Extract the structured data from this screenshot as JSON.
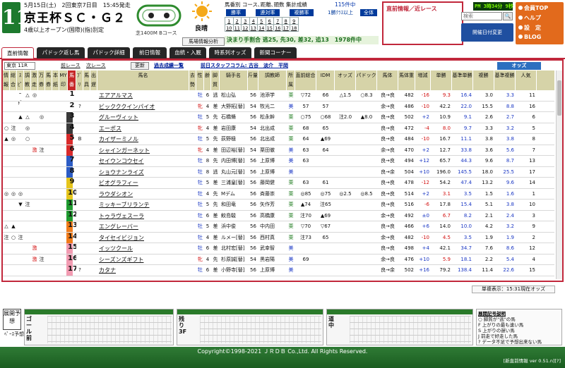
{
  "header": {
    "race_number": "11",
    "dateline": "5月15日(土)　2回東京7日目　15:45発走",
    "race_name": "京王杯ＳＣ・Ｇ２",
    "condition": "4歳以上オープン(国際)(指)別定",
    "course_distance": "芝1400M",
    "course_note": "Bコース",
    "weather": "良晴",
    "handicap_tab": "馬場情報分析"
  },
  "stats": {
    "title": "馬番別 コース､距離､頭数 集計成績",
    "count": "115件中",
    "buttons": [
      "勝率",
      "連対率",
      "複勝率",
      "1勝ｸﾗｽ以上",
      "全体"
    ],
    "row1": [
      "1",
      "2",
      "3",
      "4",
      "5",
      "6",
      "7",
      "8",
      "9"
    ],
    "row2": [
      "10",
      "11",
      "12",
      "13",
      "14",
      "15",
      "16",
      "17",
      "18"
    ],
    "underline_nums": [
      "10",
      "16",
      "17"
    ],
    "result_line": "決まり手割合 逃25, 先30, 差32, 追13　1978件中"
  },
  "direct": {
    "title": "直前情報／近レース"
  },
  "topright": {
    "clock": "PM 3時34分 9秒",
    "search_placeholder": "検索",
    "search_btn": "🔍",
    "schedule_btn": "開催日付変更",
    "menu": [
      "会員TOP",
      "ヘルプ",
      "設　定",
      "BLOG"
    ]
  },
  "tabs": [
    "直前情報",
    "パドック返し馬",
    "パドック詳細",
    "前日情報",
    "血統・入厩",
    "時系列オッズ",
    "新聞コーナー"
  ],
  "controls": {
    "race_select": "東京 11R",
    "prev": "前レース",
    "next": "次レース",
    "update": "更新",
    "past": "過去成績一覧",
    "staff": "前日スタッフコラム: 古谷　淡介　平岡",
    "odds": "オッズ"
  },
  "columns": [
    "情報",
    "総合",
    "ｽﾋﾟｰﾄﾞ",
    "調教",
    "激走",
    "万券",
    "馬券",
    "本紙",
    "MY印",
    "馬番",
    "ﾌﾞﾘ",
    "馬具",
    "出遅",
    "馬名",
    "去勢",
    "性",
    "齢",
    "脚質",
    "騎手名",
    "斤量",
    "調教師",
    "所属",
    "直前総合",
    "IDM",
    "オッズ",
    "パドック",
    "馬体",
    "馬体重",
    "増減",
    "単勝",
    "基準単勝",
    "複勝",
    "基準複勝",
    "人気"
  ],
  "horses": [
    {
      "marks": [
        "",
        "",
        "",
        "△",
        "◎",
        "",
        "",
        "",
        ""
      ],
      "no": "1",
      "gate": "#ffffff",
      "bri": "",
      "name": "エアアルマス",
      "sex": "牡",
      "age": "6",
      "style": "逃",
      "jockey": "松山弘",
      "kin": "56",
      "trainer": "池添学",
      "belong": "栗",
      "chokuzen": "▽72",
      "idm": "66",
      "odds": "△1.5",
      "paddock": "○8.3",
      "body": "良→良",
      "weight": "482",
      "diff": "-16",
      "tan": "9.3",
      "kt": "16.4",
      "fuku": "3.0",
      "kf": "3.3",
      "ninki": "11"
    },
    {
      "marks": [
        "",
        "",
        "",
        "",
        "",
        "",
        "",
        "",
        ""
      ],
      "no": "2",
      "gate": "#ffffff",
      "bri": "?",
      "name": "ビックククインパイオ",
      "sex": "牝",
      "age": "4",
      "style": "差",
      "jockey": "大野拓[替]",
      "kin": "54",
      "trainer": "牧光二",
      "belong": "美",
      "chokuzen": "57",
      "idm": "57",
      "odds": "",
      "paddock": "",
      "body": "余→良",
      "weight": "486",
      "diff": "-10",
      "tan": "42.2",
      "kt": "22.0",
      "fuku": "15.5",
      "kf": "8.8",
      "ninki": "16"
    },
    {
      "marks": [
        "",
        "",
        "▲",
        "△",
        "",
        "◎",
        "",
        "",
        ""
      ],
      "no": "3",
      "gate": "#3a3a3a",
      "bri": "",
      "name": "グルーヴィット",
      "sex": "牡",
      "age": "5",
      "style": "先",
      "jockey": "石橋脩",
      "kin": "56",
      "trainer": "松永幹",
      "belong": "栗",
      "chokuzen": "○75",
      "idm": "○68",
      "odds": "注2.0",
      "paddock": "▲8.0",
      "body": "良→良",
      "weight": "502",
      "diff": "+2",
      "tan": "10.9",
      "kt": "9.1",
      "fuku": "2.6",
      "kf": "2.7",
      "ninki": "6"
    },
    {
      "marks": [
        "○",
        "注",
        "",
        "◎",
        "",
        "",
        "",
        "",
        ""
      ],
      "no": "4",
      "gate": "#3a3a3a",
      "bri": "",
      "name": "エーポス",
      "sex": "牝",
      "age": "4",
      "style": "差",
      "jockey": "岩田康",
      "kin": "54",
      "trainer": "北出成",
      "belong": "栗",
      "chokuzen": "68",
      "idm": "65",
      "odds": "",
      "paddock": "",
      "body": "良→良",
      "weight": "472",
      "diff": "-4",
      "tan": "8.0",
      "kt": "9.7",
      "fuku": "3.3",
      "kf": "3.2",
      "ninki": "5"
    },
    {
      "marks": [
        "▲",
        "◎",
        "",
        "○",
        "",
        "",
        "",
        "",
        ""
      ],
      "no": "5",
      "gate": "#d92b2b",
      "bri": "B",
      "name": "カイザーミノル",
      "sex": "牡",
      "age": "5",
      "style": "先",
      "jockey": "荻野極",
      "kin": "56",
      "trainer": "北出成",
      "belong": "栗",
      "chokuzen": "64",
      "idm": "▲69",
      "odds": "",
      "paddock": "",
      "body": "良→良",
      "weight": "484",
      "diff": "-10",
      "tan": "16.7",
      "kt": "11.1",
      "fuku": "3.8",
      "kf": "3.8",
      "ninki": "8"
    },
    {
      "marks": [
        "",
        "",
        "",
        "",
        "激",
        "注",
        "",
        "",
        ""
      ],
      "no": "6",
      "gate": "#d92b2b",
      "bri": "",
      "name": "シャインガーネット",
      "sex": "牝",
      "age": "4",
      "style": "差",
      "jockey": "田辺裕[替]",
      "kin": "54",
      "trainer": "栗田徹",
      "belong": "美",
      "chokuzen": "63",
      "idm": "64",
      "odds": "",
      "paddock": "",
      "body": "余→良",
      "weight": "470",
      "diff": "+2",
      "tan": "12.7",
      "kt": "33.8",
      "fuku": "3.6",
      "kf": "5.6",
      "ninki": "7"
    },
    {
      "marks": [
        "",
        "",
        "",
        "",
        "",
        "",
        "",
        "",
        ""
      ],
      "no": "7",
      "gate": "#2c5cc5",
      "bri": "",
      "name": "セイウンコウセイ",
      "sex": "牡",
      "age": "8",
      "style": "先",
      "jockey": "内田博[替]",
      "kin": "56",
      "trainer": "上原博",
      "belong": "美",
      "chokuzen": "63",
      "idm": "",
      "odds": "",
      "paddock": "",
      "body": "良→良",
      "weight": "494",
      "diff": "+12",
      "tan": "65.7",
      "kt": "44.3",
      "fuku": "9.6",
      "kf": "8.7",
      "ninki": "13"
    },
    {
      "marks": [
        "",
        "",
        "",
        "",
        "",
        "",
        "",
        "",
        ""
      ],
      "no": "8",
      "gate": "#2c5cc5",
      "bri": "",
      "name": "ショウナンライズ",
      "sex": "牡",
      "age": "8",
      "style": "逃",
      "jockey": "丸山元[替]",
      "kin": "56",
      "trainer": "上原博",
      "belong": "美",
      "chokuzen": "",
      "idm": "",
      "odds": "",
      "paddock": "",
      "body": "良→余",
      "weight": "504",
      "diff": "+10",
      "tan": "196.0",
      "kt": "145.5",
      "fuku": "18.0",
      "kf": "25.5",
      "ninki": "17"
    },
    {
      "marks": [
        "",
        "",
        "",
        "",
        "",
        "",
        "",
        "",
        ""
      ],
      "no": "9",
      "gate": "#e6c51b",
      "bri": "",
      "name": "ビオグラフィー",
      "sex": "牡",
      "age": "5",
      "style": "差",
      "jockey": "三浦皇[替]",
      "kin": "56",
      "trainer": "藤岡健",
      "belong": "栗",
      "chokuzen": "63",
      "idm": "61",
      "odds": "",
      "paddock": "",
      "body": "良→良",
      "weight": "478",
      "diff": "-12",
      "tan": "54.2",
      "kt": "47.4",
      "fuku": "13.2",
      "kf": "9.6",
      "ninki": "14"
    },
    {
      "marks": [
        "◎",
        "◎",
        "◎",
        "",
        "",
        "",
        "",
        "",
        ""
      ],
      "no": "10",
      "gate": "#e6c51b",
      "bri": "",
      "name": "ラウダシオン",
      "sex": "牡",
      "age": "4",
      "style": "先",
      "jockey": "Mデム",
      "kin": "56",
      "trainer": "斉藤崇",
      "belong": "栗",
      "chokuzen": "◎85",
      "idm": "◎75",
      "odds": "◎2.5",
      "paddock": "◎8.5",
      "body": "良→良",
      "weight": "514",
      "diff": "+2",
      "tan": "3.1",
      "kt": "3.5",
      "fuku": "1.5",
      "kf": "1.6",
      "ninki": "1"
    },
    {
      "marks": [
        "",
        "",
        "▼",
        "注",
        "",
        "",
        "",
        "",
        ""
      ],
      "no": "11",
      "gate": "#1f9b2f",
      "bri": "",
      "name": "ミッキーブリランテ",
      "sex": "牡",
      "age": "5",
      "style": "先",
      "jockey": "和田竜",
      "kin": "56",
      "trainer": "矢作芳",
      "belong": "栗",
      "chokuzen": "▲74",
      "idm": "注65",
      "odds": "",
      "paddock": "",
      "body": "良→良",
      "weight": "516",
      "diff": "-6",
      "tan": "17.8",
      "kt": "15.4",
      "fuku": "5.1",
      "kf": "3.8",
      "ninki": "10"
    },
    {
      "marks": [
        "",
        "",
        "",
        "",
        "",
        "",
        "",
        "",
        ""
      ],
      "no": "12",
      "gate": "#1f9b2f",
      "bri": "",
      "name": "トゥラヴェスーラ",
      "sex": "牡",
      "age": "6",
      "style": "差",
      "jockey": "鮫島駿",
      "kin": "56",
      "trainer": "高橋康",
      "belong": "栗",
      "chokuzen": "注70",
      "idm": "▲69",
      "odds": "",
      "paddock": "",
      "body": "余→良",
      "weight": "492",
      "diff": "±0",
      "tan": "6.7",
      "kt": "8.2",
      "fuku": "2.1",
      "kf": "2.4",
      "ninki": "3"
    },
    {
      "marks": [
        "△",
        "▲",
        "",
        "",
        "",
        "",
        "",
        "",
        ""
      ],
      "no": "13",
      "gate": "#f07b1a",
      "bri": "",
      "name": "エングレーバー",
      "sex": "牡",
      "age": "5",
      "style": "差",
      "jockey": "浜中俊",
      "kin": "56",
      "trainer": "中内田",
      "belong": "栗",
      "chokuzen": "▽70",
      "idm": "▽67",
      "odds": "",
      "paddock": "",
      "body": "良→良",
      "weight": "466",
      "diff": "+6",
      "tan": "14.0",
      "kt": "10.0",
      "fuku": "4.2",
      "kf": "3.2",
      "ninki": "9"
    },
    {
      "marks": [
        "注",
        "○",
        "注",
        "",
        "",
        "",
        "",
        "",
        ""
      ],
      "no": "14",
      "gate": "#f07b1a",
      "bri": "",
      "name": "タイセイビジョン",
      "sex": "牡",
      "age": "4",
      "style": "差",
      "jockey": "ルメー[替]",
      "kin": "56",
      "trainer": "西村真",
      "belong": "栗",
      "chokuzen": "注73",
      "idm": "65",
      "odds": "",
      "paddock": "",
      "body": "余→良",
      "weight": "482",
      "diff": "-10",
      "tan": "4.5",
      "kt": "3.5",
      "fuku": "1.9",
      "kf": "1.9",
      "ninki": "2"
    },
    {
      "marks": [
        "",
        "",
        "",
        "",
        "激",
        "",
        "",
        "",
        ""
      ],
      "no": "15",
      "gate": "#f29bb2",
      "bri": "",
      "name": "イッツクール",
      "sex": "牡",
      "age": "6",
      "style": "差",
      "jockey": "北村宏[替]",
      "kin": "56",
      "trainer": "武幸智",
      "belong": "美",
      "chokuzen": "",
      "idm": "",
      "odds": "",
      "paddock": "",
      "body": "良→良",
      "weight": "498",
      "diff": "+4",
      "tan": "42.1",
      "kt": "34.7",
      "fuku": "7.6",
      "kf": "8.6",
      "ninki": "12"
    },
    {
      "marks": [
        "",
        "",
        "",
        "",
        "激",
        "注",
        "",
        "",
        ""
      ],
      "no": "16",
      "gate": "#f29bb2",
      "bri": "",
      "name": "シーズンズギフト",
      "sex": "牝",
      "age": "4",
      "style": "先",
      "jockey": "杉原誠[替]",
      "kin": "54",
      "trainer": "黒岩陽",
      "belong": "美",
      "chokuzen": "69",
      "idm": "",
      "odds": "",
      "paddock": "",
      "body": "余→良",
      "weight": "476",
      "diff": "+10",
      "tan": "5.9",
      "kt": "18.1",
      "fuku": "2.2",
      "kf": "5.4",
      "ninki": "4"
    },
    {
      "marks": [
        "",
        "",
        "",
        "",
        "",
        "",
        "",
        "",
        ""
      ],
      "no": "17",
      "gate": "#f29bb2",
      "bri": "?",
      "name": "カタナ",
      "sex": "牡",
      "age": "6",
      "style": "差",
      "jockey": "小野寺[替]",
      "kin": "56",
      "trainer": "上原博",
      "belong": "美",
      "chokuzen": "",
      "idm": "",
      "odds": "",
      "paddock": "",
      "body": "良→余",
      "weight": "502",
      "diff": "+16",
      "tan": "79.2",
      "kt": "138.4",
      "fuku": "11.4",
      "kf": "22.6",
      "ninki": "15"
    }
  ],
  "footer": {
    "update_time": "単複表示：15:31現在オッズ",
    "tenkai": "展開予想",
    "pace": "ﾍﾟｰｽ予想：",
    "panels": [
      "ゴール前",
      "残り3F",
      "道中",
      "スタート"
    ],
    "legend_title": "展開記号説明",
    "legend_lines": [
      "○ 脚質が\"逃\"の馬",
      "F 上がりの最も速い馬",
      "S 上がりの遅い馬",
      "J 前走で好走した馬",
      "? データ不足で予想出来ない馬",
      "★ その他の馬"
    ],
    "copyright": "Copyright©1998-2021 ＪＲＤＢ Co.,Ltd. All Rights Reserved.",
    "version": "[新直前情報 ver 0.51.n][?]"
  }
}
